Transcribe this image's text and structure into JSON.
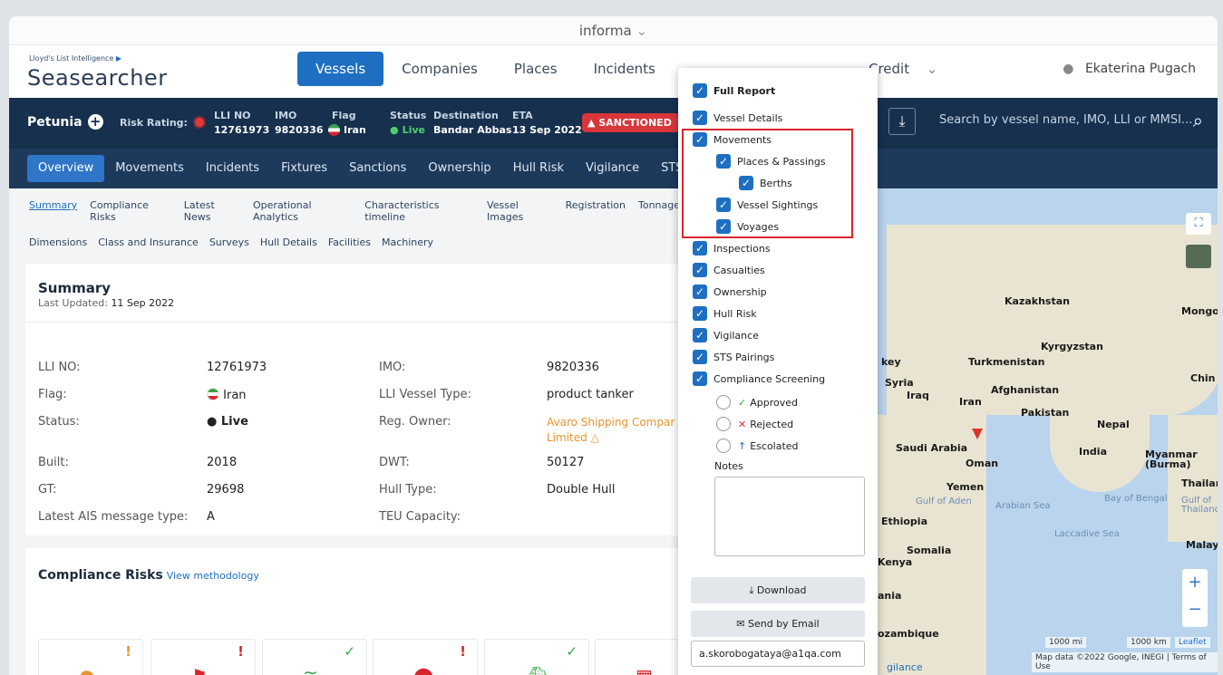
{
  "browser": {
    "title": "informa",
    "chevron": "⌄"
  },
  "header": {
    "logo_small": "Lloyd's List Intelligence",
    "logo_big": "Seasearcher",
    "nav": [
      "Vessels",
      "Companies",
      "Places",
      "Incidents"
    ],
    "credit": "Credit",
    "credit_chevron": "⌄",
    "user": "Ekaterina Pugach"
  },
  "vessel": {
    "name": "Petunia",
    "risk_label": "Risk Rating:",
    "lli_label": "LLI NO",
    "lli_value": "12761973",
    "imo_label": "IMO",
    "imo_value": "9820336",
    "flag_label": "Flag",
    "flag_value": "Iran",
    "status_label": "Status",
    "status_value": "Live",
    "dest_label": "Destination",
    "dest_value": "Bandar Abbas",
    "eta_label": "ETA",
    "eta_value": "13 Sep 2022",
    "sanctioned": "SANCTIONED",
    "search_placeholder": "Search by vessel name, IMO, LLI or MMSI..."
  },
  "tabs": [
    "Overview",
    "Movements",
    "Incidents",
    "Fixtures",
    "Sanctions",
    "Ownership",
    "Hull Risk",
    "Vigilance",
    "STS"
  ],
  "subtabs_row1": [
    "Summary",
    "Compliance Risks",
    "Latest News",
    "Operational Analytics",
    "Characteristics timeline",
    "Vessel Images",
    "Registration",
    "Tonnage"
  ],
  "subtabs_row2": [
    "Dimensions",
    "Class and Insurance",
    "Surveys",
    "Hull Details",
    "Facilities",
    "Machinery"
  ],
  "summary": {
    "title": "Summary",
    "updated_label": "Last Updated:",
    "updated_value": "11 Sep 2022",
    "left": [
      {
        "label": "LLI NO:",
        "value": "12761973"
      },
      {
        "label": "Flag:",
        "value": "Iran"
      },
      {
        "label": "Status:",
        "value": "Live"
      },
      {
        "label": "Built:",
        "value": "2018"
      },
      {
        "label": "GT:",
        "value": "29698"
      },
      {
        "label": "Latest AIS message type:",
        "value": "A"
      }
    ],
    "right": [
      {
        "label": "IMO:",
        "value": "9820336"
      },
      {
        "label": "LLI Vessel Type:",
        "value": "product tanker"
      },
      {
        "label": "Reg. Owner:",
        "value": "Avaro Shipping Compar"
      },
      {
        "label": "DWT:",
        "value": "50127"
      },
      {
        "label": "Hull Type:",
        "value": "Double Hull"
      },
      {
        "label": "TEU Capacity:",
        "value": ""
      }
    ],
    "owner_line2": "Limited"
  },
  "compliance": {
    "title": "Compliance Risks",
    "link": "View methodology"
  },
  "report": {
    "items": [
      "Full Report",
      "Vessel Details",
      "Movements",
      "Places & Passings",
      "Berths",
      "Vessel Sightings",
      "Voyages",
      "Inspections",
      "Casualties",
      "Ownership",
      "Hull Risk",
      "Vigilance",
      "STS Pairings",
      "Compliance Screening"
    ],
    "screening": [
      "Approved",
      "Rejected",
      "Escolated"
    ],
    "notes_label": "Notes",
    "download": "Download",
    "email_btn": "Send by Email",
    "email_value": "a.skorobogataya@a1qa.com"
  },
  "map": {
    "labels": [
      "Kazakhstan",
      "Mongol",
      "Kyrgyzstan",
      "Turkmenistan",
      "key",
      "Syria",
      "Iraq",
      "Iran",
      "Afghanistan",
      "Chin",
      "Pakistan",
      "Nepal",
      "Saudi Arabia",
      "Oman",
      "India",
      "Myanmar (Burma)",
      "Yemen",
      "Thailand",
      "Ethiopia",
      "Somalia",
      "Malay",
      "Kenya",
      "ania",
      "ozambique"
    ],
    "seas": [
      "Gulf of Aden",
      "Arabian Sea",
      "Bay of Bengal",
      "Gulf of Thailand",
      "Laccadive Sea"
    ],
    "scale_mi": "1000 mi",
    "scale_km": "1000 km",
    "leaflet": "Leaflet",
    "attribution": "Map data ©2022 Google, INEGI | Terms of Use",
    "footer_link": "gilance"
  }
}
